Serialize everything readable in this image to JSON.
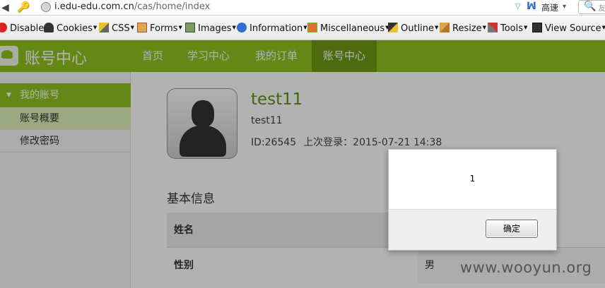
{
  "browser": {
    "url_host": "i.edu-edu.com.cn",
    "url_path": "/cas/home/index",
    "speed_label": "高速",
    "search_placeholder": "友"
  },
  "toolbar": {
    "items": [
      {
        "label": "Disable",
        "icon": "no-entry-icon"
      },
      {
        "label": "Cookies",
        "icon": "user-silhouette-icon"
      },
      {
        "label": "CSS",
        "icon": "pencil-icon"
      },
      {
        "label": "Forms",
        "icon": "clipboard-icon"
      },
      {
        "label": "Images",
        "icon": "picture-icon"
      },
      {
        "label": "Information",
        "icon": "info-icon"
      },
      {
        "label": "Miscellaneous",
        "icon": "book-icon"
      },
      {
        "label": "Outline",
        "icon": "outline-pen-icon"
      },
      {
        "label": "Resize",
        "icon": "ruler-icon"
      },
      {
        "label": "Tools",
        "icon": "tools-icon"
      },
      {
        "label": "View Source",
        "icon": "monitor-icon"
      }
    ]
  },
  "site": {
    "brand": "账号中心",
    "nav": [
      {
        "label": "首页"
      },
      {
        "label": "学习中心"
      },
      {
        "label": "我的订单"
      },
      {
        "label": "账号中心",
        "active": true
      }
    ]
  },
  "sidebar": {
    "section": "我的账号",
    "items": [
      {
        "label": "账号概要",
        "selected": true
      },
      {
        "label": "修改密码"
      }
    ]
  },
  "profile": {
    "username": "test11",
    "display_name": "test11",
    "id_text": "ID:26545",
    "last_login": "上次登录：2015-07-21 14:38"
  },
  "basic_info": {
    "title": "基本信息",
    "rows": [
      {
        "label": "姓名",
        "value": ""
      },
      {
        "label": "性别",
        "value": "男"
      }
    ]
  },
  "dialog": {
    "message": "1",
    "ok_label": "确定"
  },
  "watermark": "www.wooyun.org",
  "colors": {
    "brand_green": "#8fc31f",
    "active_nav": "#6e9a12",
    "username_green": "#5e9410"
  }
}
